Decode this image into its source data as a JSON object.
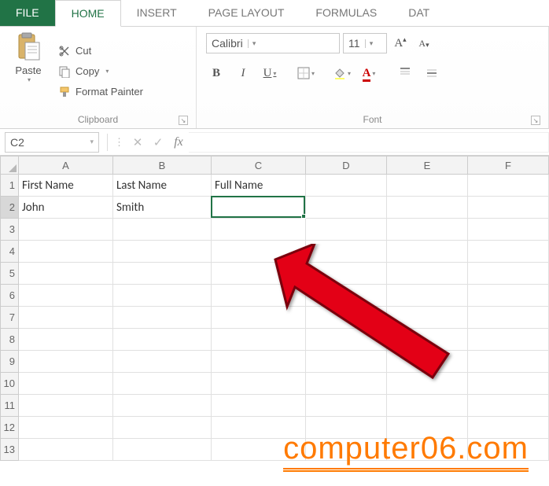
{
  "tabs": {
    "file": "FILE",
    "home": "HOME",
    "insert": "INSERT",
    "pagelayout": "PAGE LAYOUT",
    "formulas": "FORMULAS",
    "data": "DAT"
  },
  "clipboard": {
    "paste": "Paste",
    "cut": "Cut",
    "copy": "Copy",
    "format_painter": "Format Painter",
    "group_label": "Clipboard"
  },
  "font": {
    "name": "Calibri",
    "size": "11",
    "group_label": "Font",
    "bold": "B",
    "italic": "I",
    "underline": "U",
    "letterA": "A"
  },
  "namebox": "C2",
  "columns": [
    "A",
    "B",
    "C",
    "D",
    "E",
    "F"
  ],
  "rows_visible": 13,
  "data_cells": {
    "A1": "First Name",
    "B1": "Last Name",
    "C1": "Full Name",
    "A2": "John",
    "B2": "Smith"
  },
  "selection": {
    "col": "C",
    "row": 2
  },
  "watermark": "computer06.com"
}
